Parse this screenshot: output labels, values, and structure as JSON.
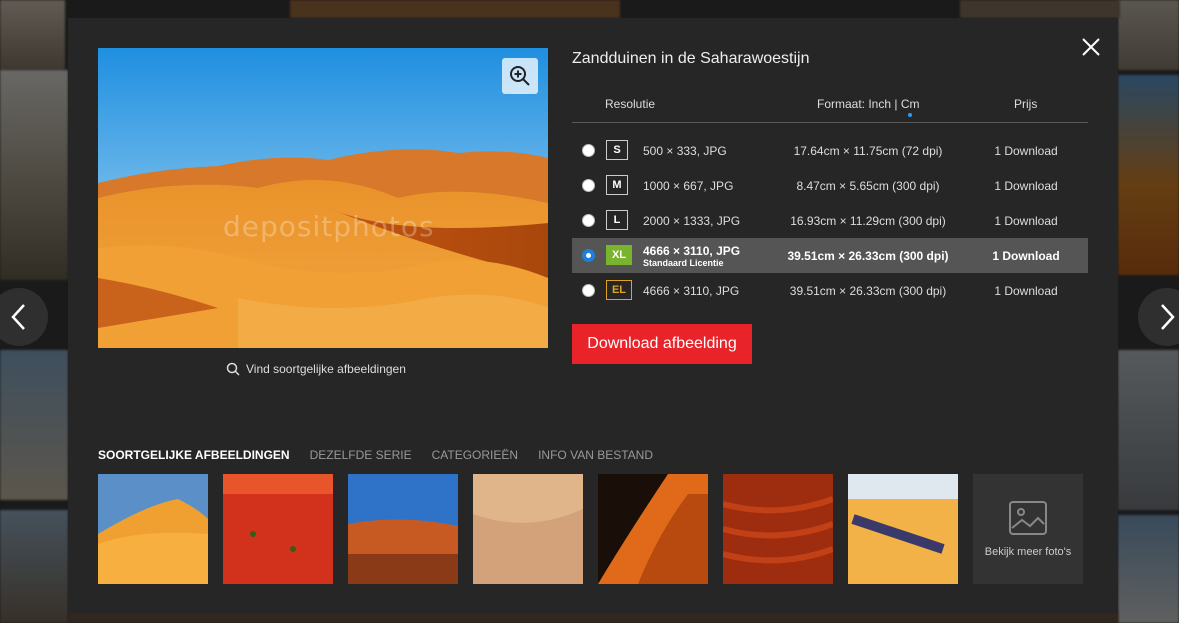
{
  "dialog": {
    "title": "Zandduinen in de Saharawoestijn",
    "watermark": "depositphotos",
    "similar_link": "Vind soortgelijke afbeeldingen"
  },
  "table": {
    "headers": {
      "resolution": "Resolutie",
      "format": "Formaat: Inch | Cm",
      "price": "Prijs"
    },
    "rows": [
      {
        "size": "S",
        "resolution": "500 × 333, JPG",
        "license": "",
        "dimensions": "17.64cm × 11.75cm (72 dpi)",
        "price": "1 Download",
        "selected": false
      },
      {
        "size": "M",
        "resolution": "1000 × 667, JPG",
        "license": "",
        "dimensions": "8.47cm × 5.65cm (300 dpi)",
        "price": "1 Download",
        "selected": false
      },
      {
        "size": "L",
        "resolution": "2000 × 1333, JPG",
        "license": "",
        "dimensions": "16.93cm × 11.29cm (300 dpi)",
        "price": "1 Download",
        "selected": false
      },
      {
        "size": "XL",
        "resolution": "4666 × 3110, JPG",
        "license": "Standaard Licentie",
        "dimensions": "39.51cm × 26.33cm (300 dpi)",
        "price": "1 Download",
        "selected": true
      },
      {
        "size": "EL",
        "resolution": "4666 × 3110, JPG",
        "license": "",
        "dimensions": "39.51cm × 26.33cm (300 dpi)",
        "price": "1 Download",
        "selected": false
      }
    ]
  },
  "download_button": "Download afbeelding",
  "tabs": [
    "SOORTGELIJKE AFBEELDINGEN",
    "DEZELFDE SERIE",
    "CATEGORIEËN",
    "INFO VAN BESTAND"
  ],
  "more_photos": "Bekijk meer foto's",
  "colors": {
    "accent_red": "#e8232a",
    "xl_badge": "#7ab32e",
    "el_badge": "#e0a325",
    "radio_selected": "#1d7fe0"
  },
  "icons": [
    "close-icon",
    "zoom-in-icon",
    "search-icon",
    "image-placeholder-icon",
    "chevron-left-icon",
    "chevron-right-icon"
  ]
}
